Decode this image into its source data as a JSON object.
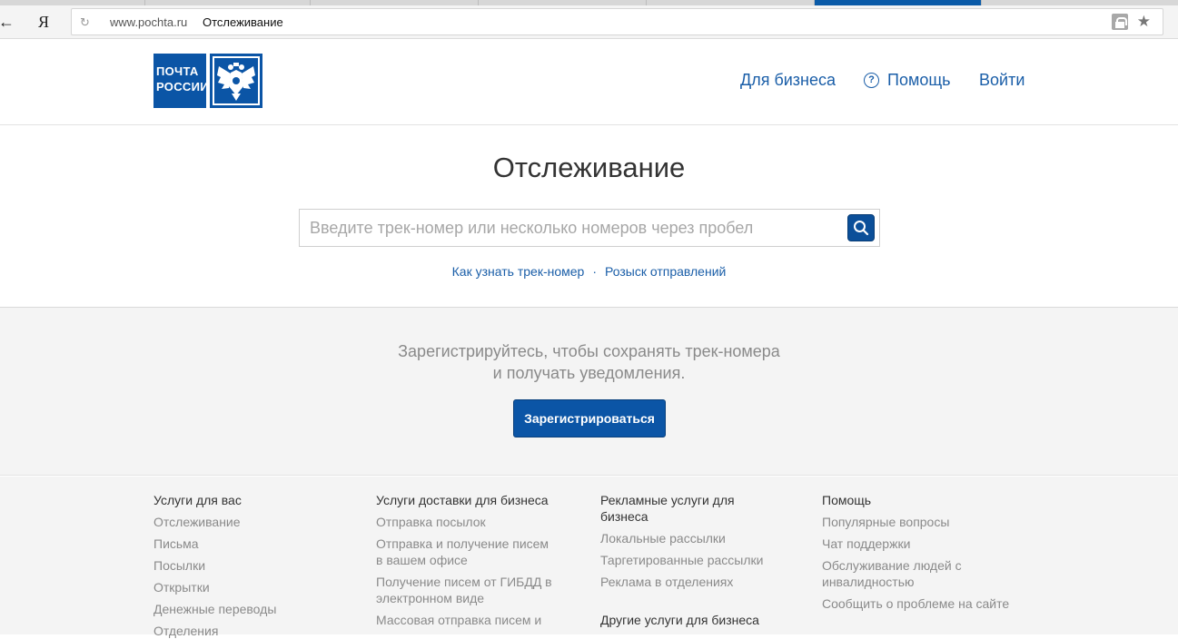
{
  "browser": {
    "back_glyph": "←",
    "yandex_glyph": "Я",
    "reload_glyph": "↻",
    "url_host": "www.pochta.ru",
    "url_title": "Отслеживание",
    "star_glyph": "★"
  },
  "header": {
    "logo_line1": "ПОЧТА",
    "logo_line2": "РОССИИ",
    "nav_business": "Для бизнеса",
    "nav_help": "Помощь",
    "help_glyph": "?",
    "nav_login": "Войти"
  },
  "tracking": {
    "title": "Отслеживание",
    "search_placeholder": "Введите трек-номер или несколько номеров через пробел",
    "link_how": "Как узнать трек-номер",
    "separator": "·",
    "link_search": "Розыск отправлений"
  },
  "register": {
    "text_line1": "Зарегистрируйтесь, чтобы сохранять трек-номера",
    "text_line2": "и получать уведомления.",
    "button_label": "Зарегистрироваться"
  },
  "footer": {
    "col1": {
      "title": "Услуги для вас",
      "items": [
        "Отслеживание",
        "Письма",
        "Посылки",
        "Открытки",
        "Денежные переводы",
        "Отделения"
      ]
    },
    "col2": {
      "title": "Услуги доставки для бизнеса",
      "items": [
        "Отправка посылок",
        "Отправка и получение писем в вашем офисе",
        "Получение писем от ГИБДД в электронном виде",
        "Массовая отправка писем и"
      ]
    },
    "col3": {
      "title": "Рекламные услуги для бизнеса",
      "items": [
        "Локальные рассылки",
        "Таргетированные рассылки",
        "Реклама в отделениях"
      ],
      "subtitle": "Другие услуги для бизнеса"
    },
    "col4": {
      "title": "Помощь",
      "items": [
        "Популярные вопросы",
        "Чат поддержки",
        "Обслуживание людей с инвалидностью",
        "Сообщить о проблеме на сайте"
      ]
    }
  },
  "colors": {
    "brand_blue": "#0b55a6",
    "link_blue": "#1a5ea8",
    "muted_gray": "#8a8a8a",
    "section_gray": "#f4f4f4"
  }
}
